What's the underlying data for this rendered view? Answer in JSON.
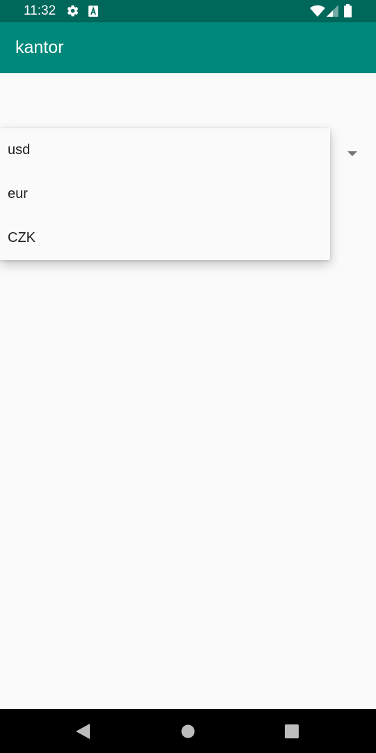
{
  "status_bar": {
    "time": "11:32",
    "icons": [
      "gear-icon",
      "font-a-icon",
      "wifi-icon",
      "signal-icon",
      "battery-icon"
    ]
  },
  "app_bar": {
    "title": "kantor",
    "color": "#00897b"
  },
  "spinner": {
    "options": [
      "usd",
      "eur",
      "CZK"
    ]
  },
  "nav_bar": {
    "buttons": [
      "back-icon",
      "home-icon",
      "recents-icon"
    ]
  },
  "colors": {
    "status_bar": "#00675b",
    "app_bar": "#00897b",
    "background": "#fafafa",
    "text": "#212121"
  }
}
